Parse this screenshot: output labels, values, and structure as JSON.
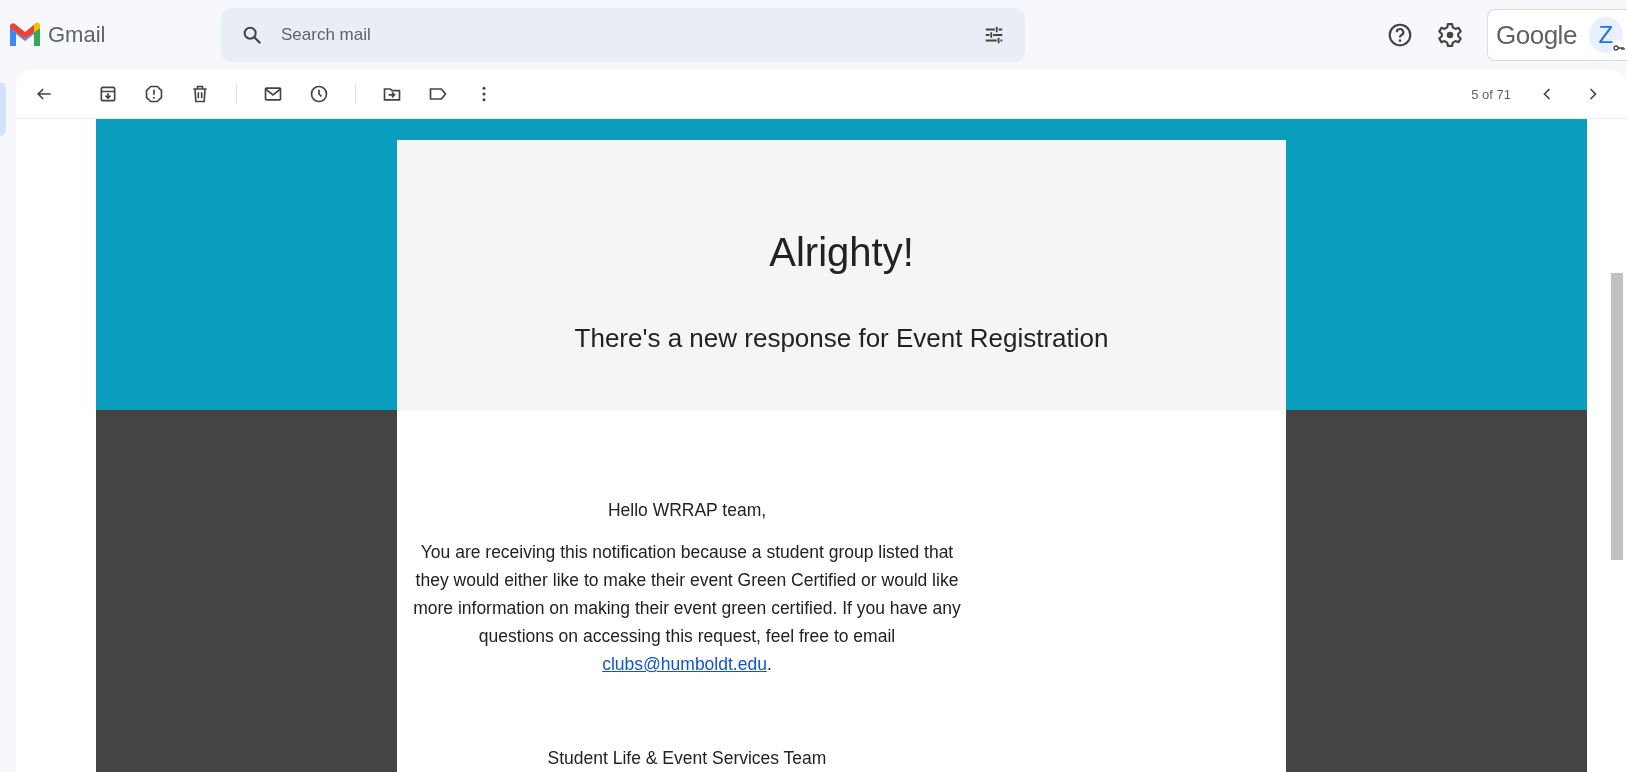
{
  "app": {
    "name": "Gmail"
  },
  "search": {
    "placeholder": "Search mail"
  },
  "account": {
    "brand": "Google",
    "initial": "Z"
  },
  "toolbar": {
    "counter": "5 of 71"
  },
  "email": {
    "title": "Alrighty!",
    "subtitle": "There's a new response for Event Registration",
    "greeting": "Hello WRRAP team,",
    "paragraph": "You are receiving this notification because a student group listed that they would either like to make their event Green Certified or would like more information on making their event green certified. If you have any questions on accessing this request, feel free to email",
    "link": "clubs@humboldt.edu",
    "link_suffix": ".",
    "signature": "Student Life & Event Services Team"
  }
}
